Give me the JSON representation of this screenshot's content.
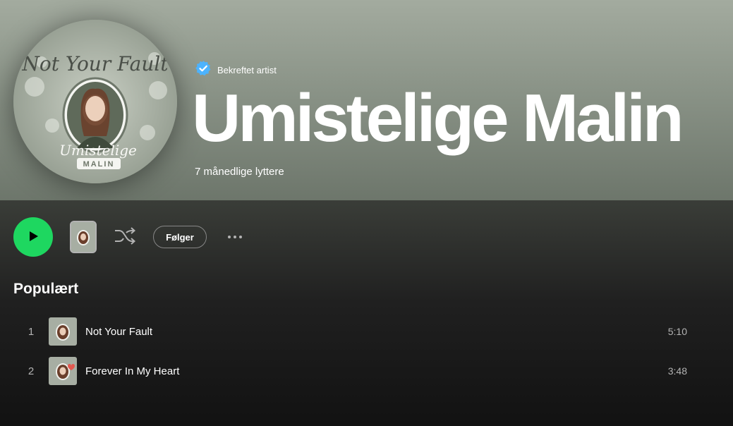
{
  "artist": {
    "verified_label": "Bekreftet artist",
    "name": "Umistelige Malin",
    "monthly_listeners": "7 månedlige lyttere",
    "avatar_text_top": "Not Your Fault",
    "avatar_text_bottom_script": "Umistelige",
    "avatar_text_bottom_badge": "MALIN"
  },
  "controls": {
    "follow_label": "Følger"
  },
  "popular": {
    "title": "Populært",
    "tracks": [
      {
        "number": "1",
        "title": "Not Your Fault",
        "duration": "5:10"
      },
      {
        "number": "2",
        "title": "Forever In My Heart",
        "duration": "3:48"
      }
    ]
  },
  "colors": {
    "accent": "#1ed760",
    "verified_badge": "#4cb3ff",
    "background": "#121212"
  },
  "icons": [
    "verified-badge-icon",
    "play-icon",
    "shuffle-icon",
    "more-options-icon"
  ]
}
